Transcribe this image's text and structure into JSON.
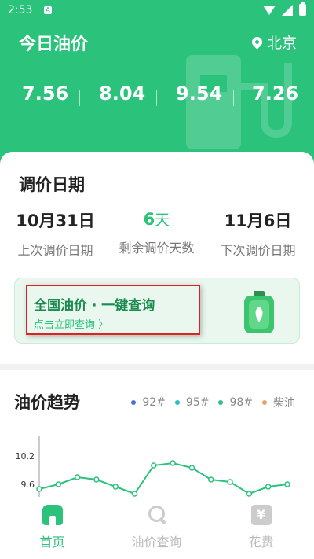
{
  "status_bar": {
    "time": "2:53",
    "notification": "A"
  },
  "header": {
    "title": "今日油价",
    "location": "北京",
    "prices": [
      "7.56",
      "8.04",
      "9.54",
      "7.26"
    ]
  },
  "adjust": {
    "title": "调价日期",
    "last": {
      "value": "10月31日",
      "label": "上次调价日期"
    },
    "remaining": {
      "value": "6",
      "unit": "天",
      "label": "剩余调价天数"
    },
    "next": {
      "value": "11月6日",
      "label": "下次调价日期"
    }
  },
  "query_banner": {
    "title": "全国油价 · 一键查询",
    "subtitle": "点击立即查询 〉"
  },
  "trend": {
    "title": "油价趋势",
    "legend": [
      {
        "name": "92#",
        "color": "#4a6fd6"
      },
      {
        "name": "95#",
        "color": "#2bbcc4"
      },
      {
        "name": "98#",
        "color": "#2bc27b"
      },
      {
        "name": "柴油",
        "color": "#e8a46a"
      }
    ]
  },
  "chart_data": {
    "type": "line",
    "ytick_labels": [
      "10.2",
      "9.6"
    ],
    "yticks": [
      10.2,
      9.6
    ],
    "ylim": [
      9.2,
      10.6
    ],
    "series": [
      {
        "name": "98#",
        "color": "#2bc27b",
        "values": [
          9.5,
          9.6,
          9.75,
          9.7,
          9.55,
          9.4,
          10.0,
          10.05,
          9.95,
          9.7,
          9.65,
          9.4,
          9.55,
          9.6
        ]
      }
    ]
  },
  "nav": {
    "items": [
      {
        "label": "首页",
        "icon": "home-icon",
        "active": true
      },
      {
        "label": "油价查询",
        "icon": "search-icon",
        "active": false
      },
      {
        "label": "花费",
        "icon": "yen-icon",
        "active": false
      }
    ],
    "yen_glyph": "¥"
  }
}
